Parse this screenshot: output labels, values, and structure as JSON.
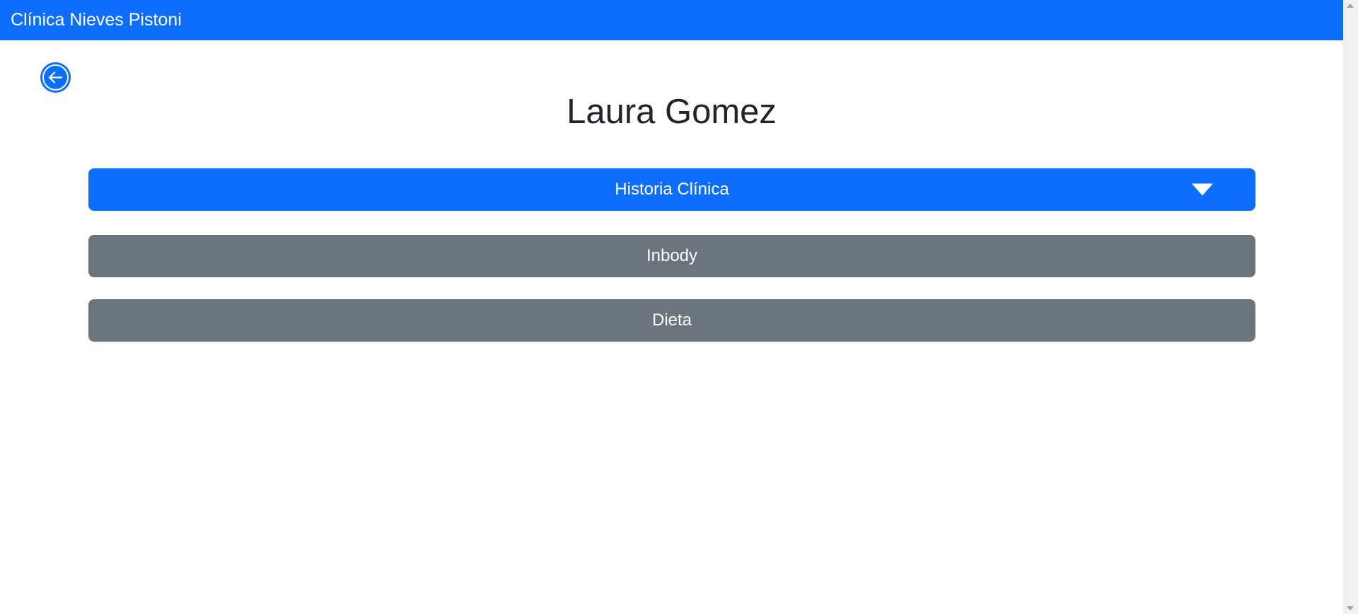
{
  "navbar": {
    "brand": "Clínica Nieves Pistoni"
  },
  "back_button": {
    "icon": "arrow-left-circle-icon"
  },
  "patient": {
    "name": "Laura Gomez"
  },
  "sections": [
    {
      "label": "Historia Clínica",
      "style": "primary",
      "expanded_indicator": "caret-down-icon"
    },
    {
      "label": "Inbody",
      "style": "secondary"
    },
    {
      "label": "Dieta",
      "style": "secondary"
    }
  ],
  "colors": {
    "primary": "#0d6efd",
    "secondary": "#6c757d",
    "text_dark": "#212529"
  }
}
